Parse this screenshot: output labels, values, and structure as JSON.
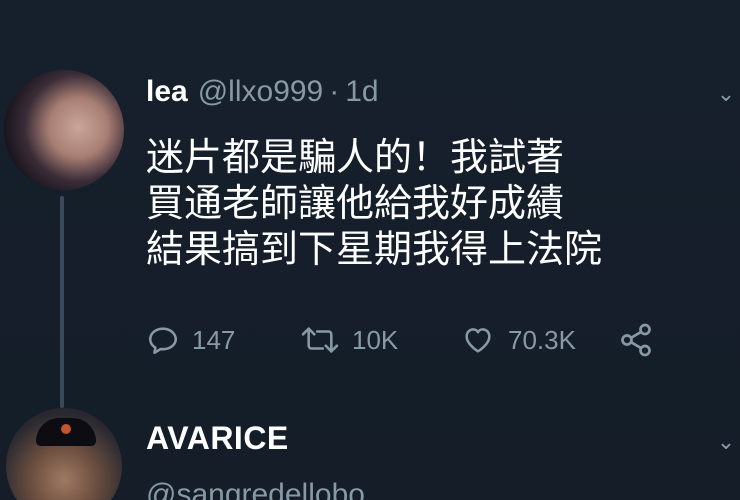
{
  "tweet": {
    "display_name": "lea",
    "handle": "@llxo999",
    "separator": "·",
    "age": "1d",
    "text_lines": [
      "迷片都是騙人的！我試著",
      "買通老師讓他給我好成績",
      "結果搞到下星期我得上法院"
    ],
    "actions": {
      "replies": "147",
      "retweets": "10K",
      "likes": "70.3K"
    }
  },
  "reply": {
    "display_name": "AVARICE",
    "handle": "@sangredellobo"
  },
  "icons": {
    "reply": "reply-icon",
    "retweet": "retweet-icon",
    "like": "heart-icon",
    "share": "share-icon",
    "menu": "chevron-down-icon"
  },
  "colors": {
    "background": "#15202b",
    "secondary_text": "#8899a6",
    "primary_text": "#ffffff"
  }
}
